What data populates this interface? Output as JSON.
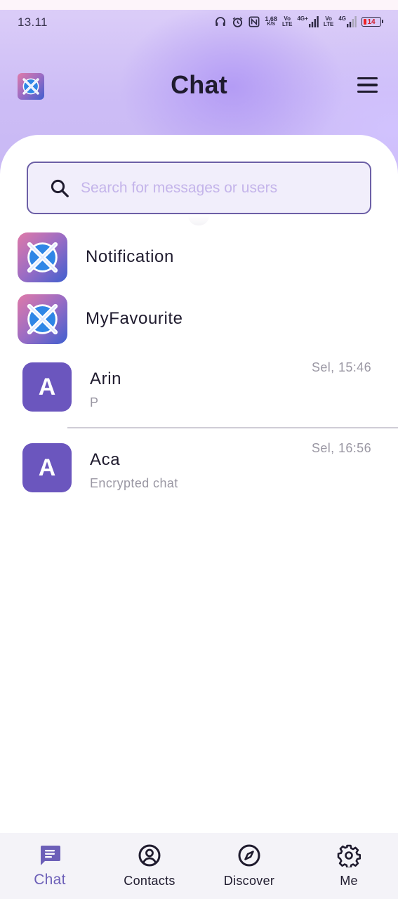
{
  "status_bar": {
    "time": "13.11",
    "net_speed_value": "1,68",
    "net_speed_unit": "K/S",
    "volte1_top": "Vo",
    "volte1_bottom": "LTE",
    "net1": "4G+",
    "volte2_top": "Vo",
    "volte2_bottom": "LTE",
    "net2": "4G",
    "battery": "14"
  },
  "header": {
    "title": "Chat"
  },
  "search": {
    "placeholder": "Search for messages or users",
    "value": ""
  },
  "system_items": [
    {
      "label": "Notification"
    },
    {
      "label": "MyFavourite"
    }
  ],
  "chats": [
    {
      "avatar_letter": "A",
      "name": "Arin",
      "preview": "P",
      "time": "Sel, 15:46"
    },
    {
      "avatar_letter": "A",
      "name": "Aca",
      "preview": "Encrypted chat",
      "time": "Sel, 16:56"
    }
  ],
  "bottom_nav": [
    {
      "label": "Chat",
      "icon": "chat-bubble-icon",
      "active": true
    },
    {
      "label": "Contacts",
      "icon": "user-circle-icon",
      "active": false
    },
    {
      "label": "Discover",
      "icon": "compass-icon",
      "active": false
    },
    {
      "label": "Me",
      "icon": "gear-icon",
      "active": false
    }
  ],
  "colors": {
    "accent": "#6c5fb8",
    "avatar_bg": "#6b56be",
    "header_gradient": "#cdbdf6",
    "search_border": "#6c5fa6"
  }
}
